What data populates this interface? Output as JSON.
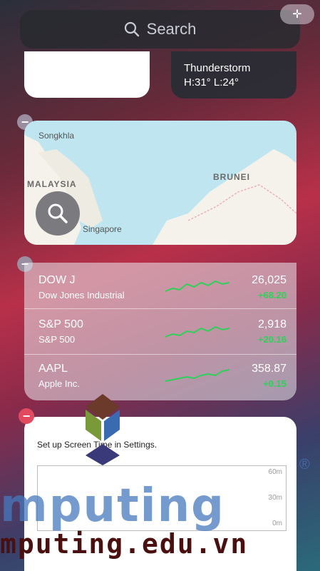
{
  "search": {
    "label": "Search"
  },
  "weather": {
    "condition": "Thunderstorm",
    "temps": "H:31° L:24°"
  },
  "map": {
    "labels": {
      "songkhla": "Songkhla",
      "malaysia": "MALAYSIA",
      "brunei": "BRUNEI",
      "singapore": "Singapore"
    }
  },
  "stocks": {
    "rows": [
      {
        "symbol": "DOW J",
        "name": "Dow Jones Industrial",
        "price": "26,025",
        "change": "+68.20"
      },
      {
        "symbol": "S&P 500",
        "name": "S&P 500",
        "price": "2,918",
        "change": "+20.16"
      },
      {
        "symbol": "AAPL",
        "name": "Apple Inc.",
        "price": "358.87",
        "change": "+0.15"
      }
    ]
  },
  "screen_time": {
    "message": "Set up Screen Time in Settings.",
    "axis": [
      "60m",
      "30m",
      "0m"
    ]
  },
  "watermark": {
    "text": "mputing",
    "url": "mputing.edu.vn",
    "reg": "®"
  },
  "colors": {
    "accent_green": "#2ed158",
    "remove_red": "#e24a5f",
    "map_water": "#bfe6f0"
  }
}
